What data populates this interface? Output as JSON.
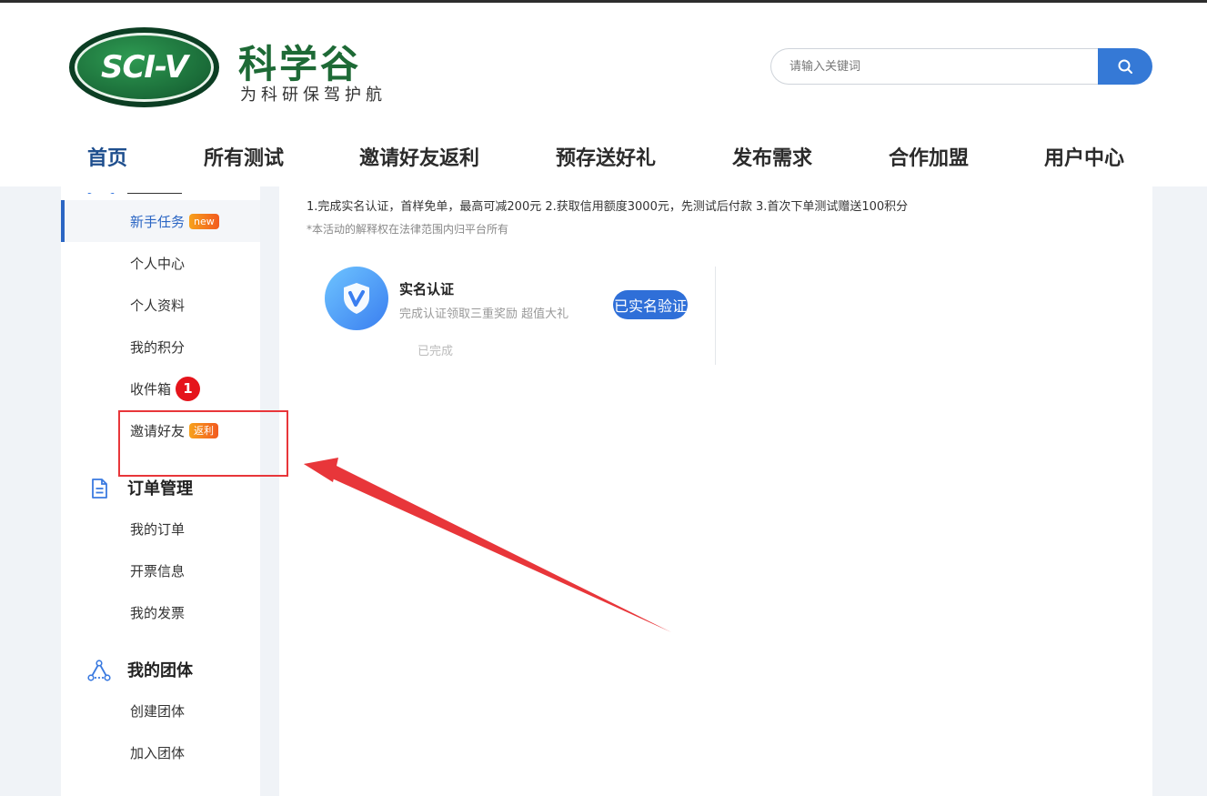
{
  "brand": {
    "logo_text": "SCI-V",
    "title": "科学谷",
    "slogan": "为科研保驾护航"
  },
  "search": {
    "placeholder": "请输入关键词",
    "icon": "search-icon"
  },
  "nav": [
    {
      "label": "首页",
      "active": true
    },
    {
      "label": "所有测试"
    },
    {
      "label": "邀请好友返利"
    },
    {
      "label": "预存送好礼"
    },
    {
      "label": "发布需求"
    },
    {
      "label": "合作加盟"
    },
    {
      "label": "用户中心"
    }
  ],
  "sidebar": {
    "account_items": [
      {
        "label": "新手任务",
        "badge": "new",
        "active": true
      },
      {
        "label": "个人中心"
      },
      {
        "label": "个人资料"
      },
      {
        "label": "我的积分"
      },
      {
        "label": "收件箱",
        "count": "1"
      },
      {
        "label": "邀请好友",
        "badge": "返利"
      }
    ],
    "order_section": {
      "title": "订单管理",
      "icon": "document-icon",
      "items": [
        "我的订单",
        "开票信息",
        "我的发票"
      ]
    },
    "team_section": {
      "title": "我的团体",
      "icon": "network-icon",
      "items": [
        "创建团体",
        "加入团体"
      ]
    }
  },
  "main": {
    "benefits": "1.完成实名认证，首样免单，最高可减200元 2.获取信用额度3000元，先测试后付款 3.首次下单测试赠送100积分",
    "disclaimer": "*本活动的解释权在法律范围内归平台所有",
    "task": {
      "title": "实名认证",
      "subtitle": "完成认证领取三重奖励 超值大礼",
      "button": "已实名验证",
      "status": "已完成",
      "icon": "verified-shield-icon"
    }
  },
  "colors": {
    "primary": "#2f6fd8",
    "brand_green": "#1e6a36",
    "nav_active": "#1f4f8e",
    "badge_orange": "#f25a1f",
    "alert_red": "#e5141b",
    "annotation_red": "#e8363a"
  }
}
